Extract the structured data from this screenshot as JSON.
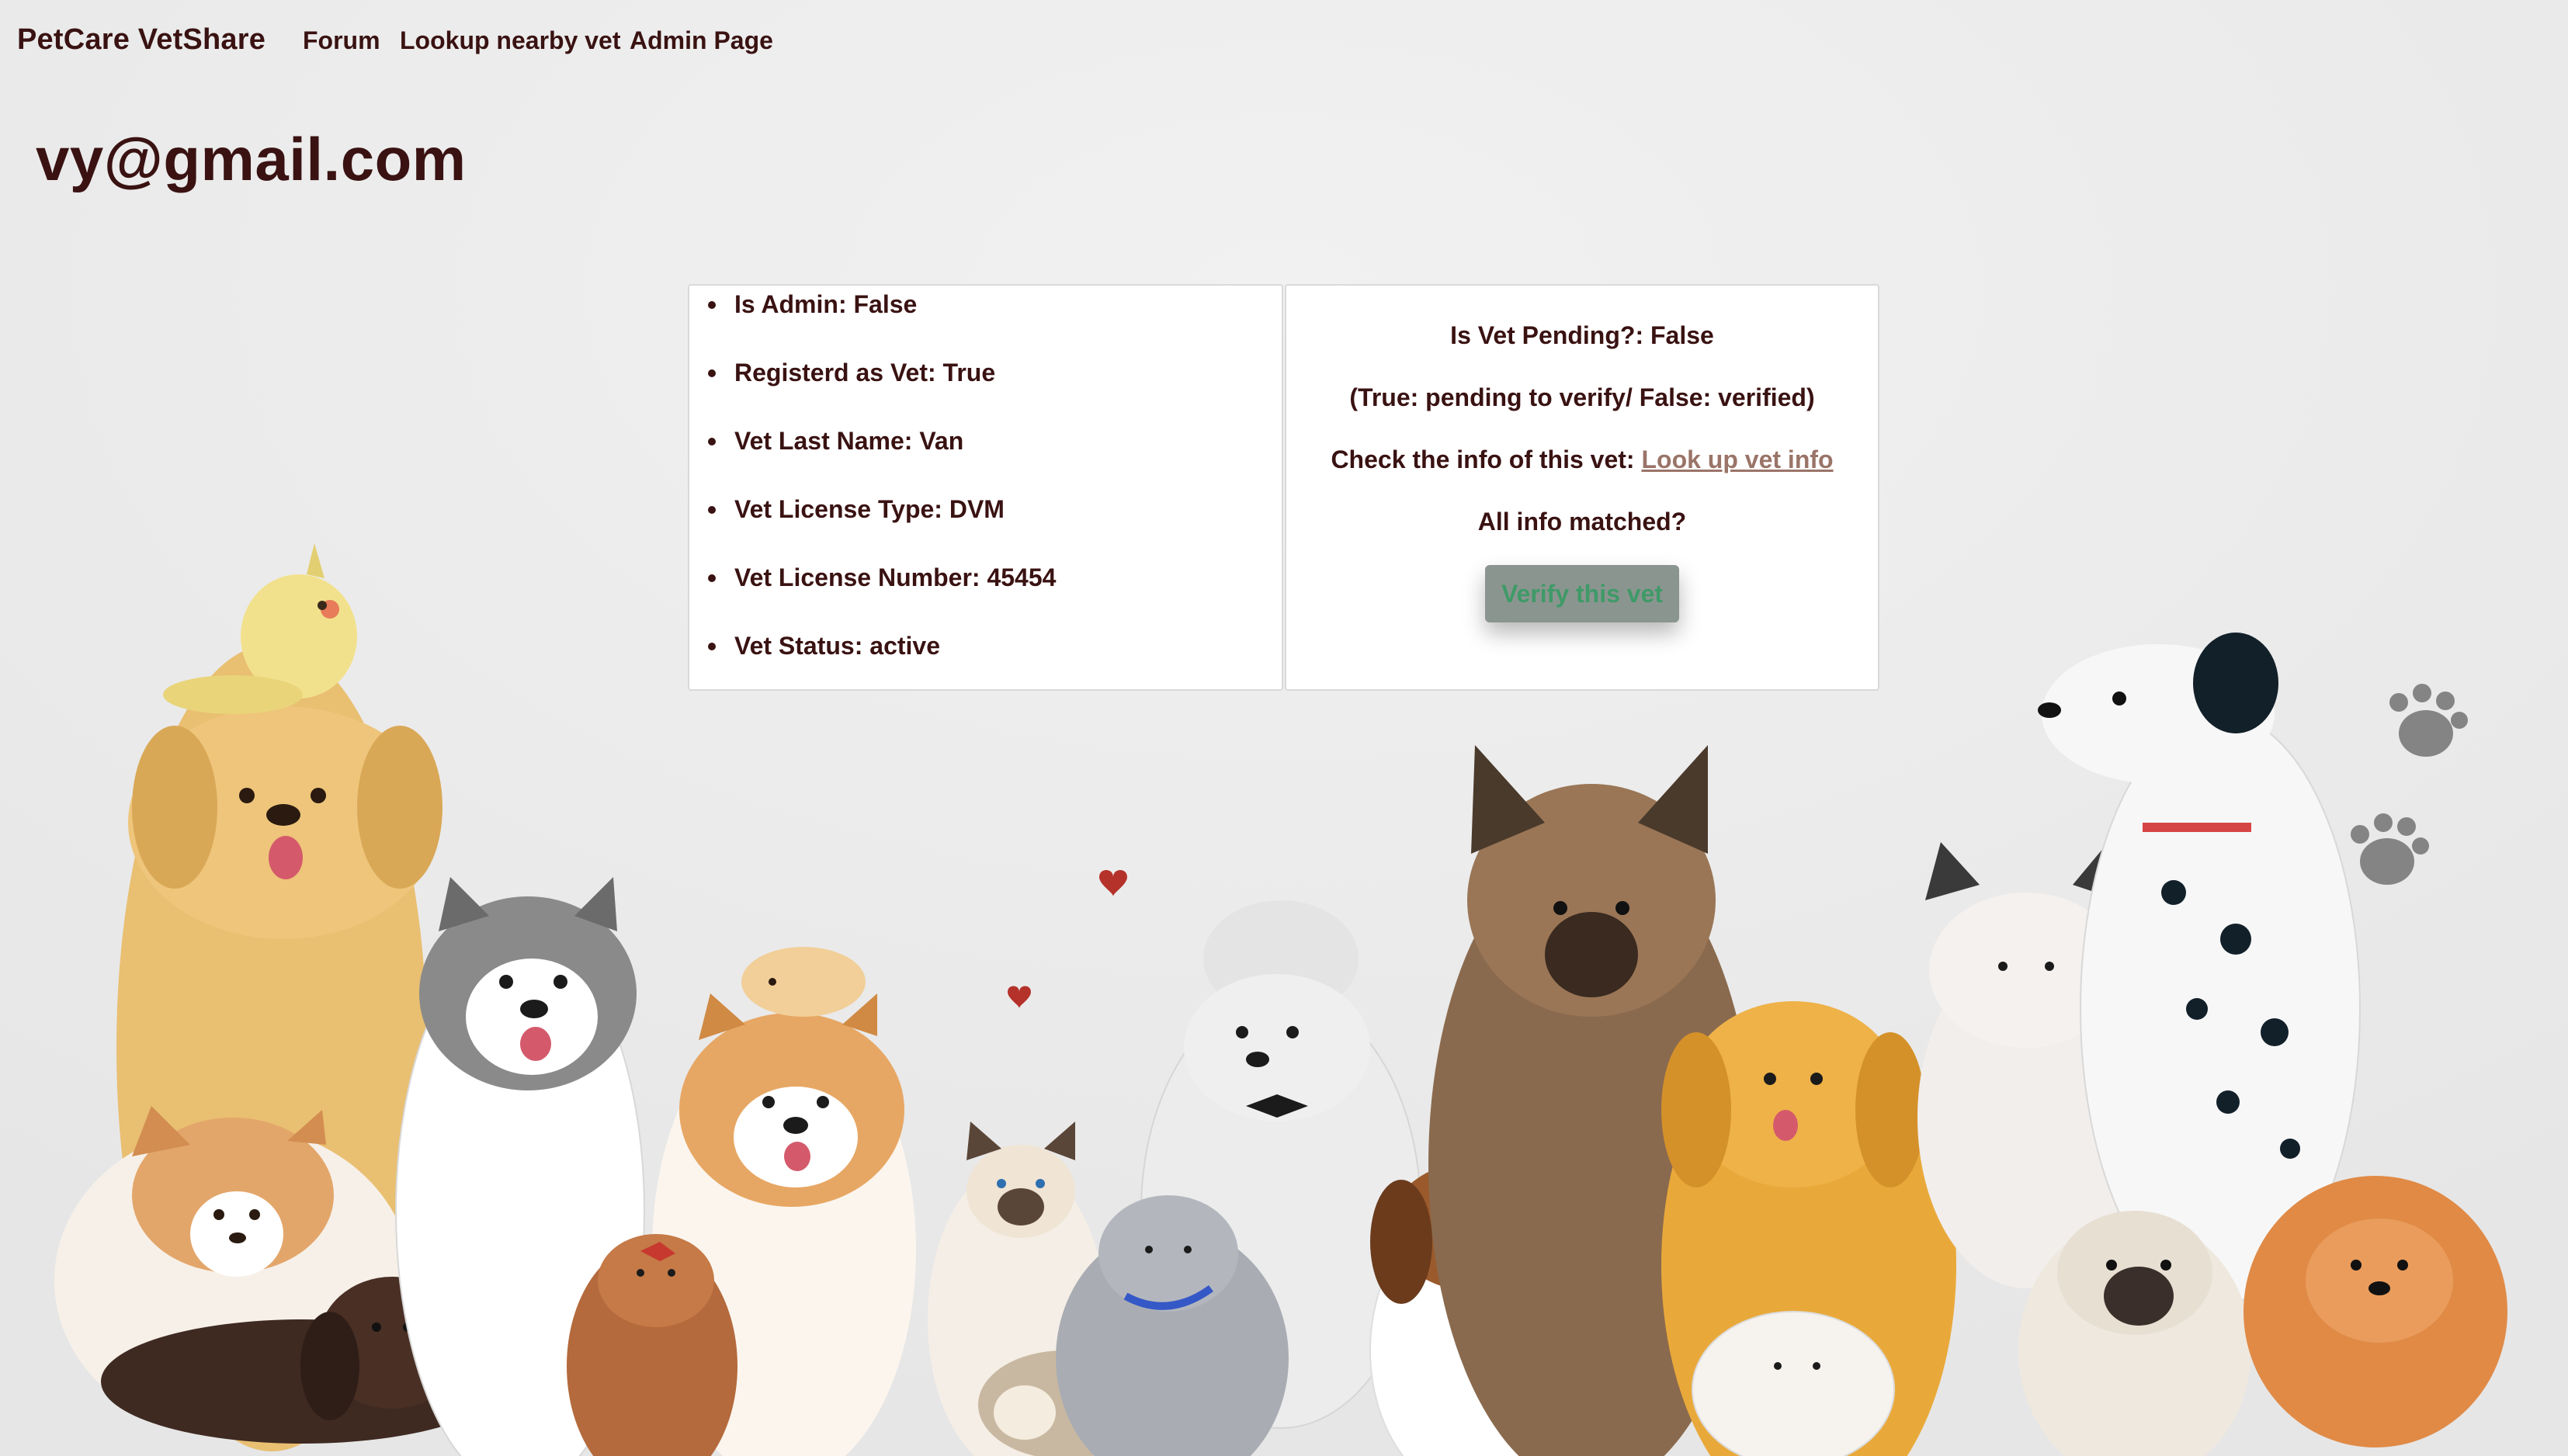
{
  "navbar": {
    "brand": "PetCare VetShare",
    "links": [
      "Forum",
      "Lookup nearby vet",
      "Admin Page"
    ]
  },
  "page": {
    "title": "vy@gmail.com"
  },
  "user_info": {
    "items": [
      "Is Admin: False",
      "Registerd as Vet: True",
      "Vet Last Name: Van",
      "Vet License Type: DVM",
      "Vet License Number: 45454",
      "Vet Status: active"
    ]
  },
  "verification": {
    "pending": "Is Vet Pending?: False",
    "legend": "(True: pending to verify/ False: verified)",
    "check_prefix": "Check the info of this vet: ",
    "check_link": "Look up vet info",
    "question": "All info matched?",
    "button": "Verify this vet"
  },
  "colors": {
    "text": "#3a1212",
    "link": "#9a7468",
    "button_bg": "#8b958f",
    "button_text": "#3f9a68",
    "background": "#ececec"
  }
}
